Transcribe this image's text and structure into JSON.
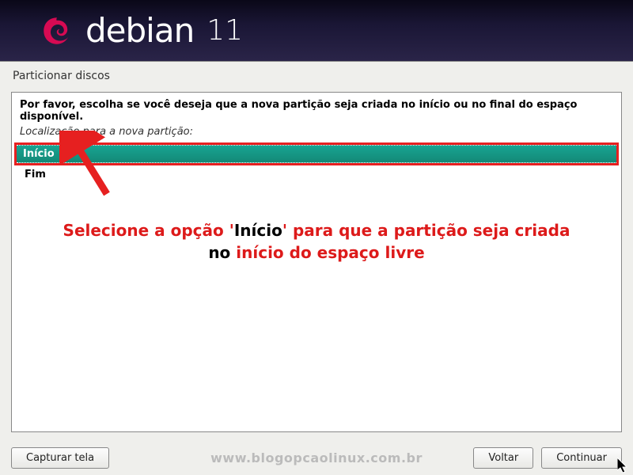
{
  "header": {
    "brand": "debian",
    "version": "11"
  },
  "screen": {
    "title": "Particionar discos",
    "instruction": "Por favor, escolha se você deseja que a nova partição seja criada no início ou no final do espaço disponível.",
    "subtitle": "Localização para a nova partição:"
  },
  "options": {
    "selected": "Início",
    "unselected": "Fim"
  },
  "annotation": {
    "line1_red1": "Selecione a opção '",
    "line1_black1": "Início",
    "line1_red2": "' para que a partição seja criada",
    "line2_black1": "no ",
    "line2_red1": "início do espaço livre"
  },
  "buttons": {
    "screenshot": "Capturar tela",
    "back": "Voltar",
    "continue": "Continuar"
  },
  "watermark": "www.blogopcaolinux.com.br",
  "colors": {
    "accent": "#159a87",
    "highlight": "#e62020",
    "header_bg": "#1a1635"
  }
}
